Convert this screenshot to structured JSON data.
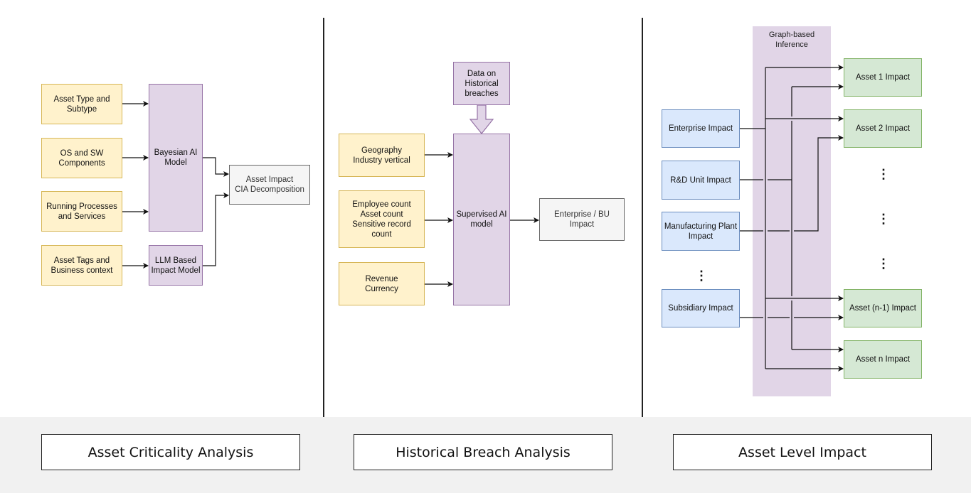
{
  "panel1": {
    "inputs": [
      "Asset Type and\nSubtype",
      "OS and SW\nComponents",
      "Running Processes\nand Services",
      "Asset Tags and\nBusiness context"
    ],
    "bayesian_model": "Bayesian AI\nModel",
    "llm_model": "LLM Based\nImpact Model",
    "output": "Asset Impact\nCIA Decomposition"
  },
  "panel2": {
    "historical_data": "Data on\nHistorical\nbreaches",
    "inputs": [
      "Geography\nIndustry vertical",
      "Employee count\nAsset count\nSensitive record\ncount",
      "Revenue\nCurrency"
    ],
    "model": "Supervised AI\nmodel",
    "output": "Enterprise / BU\nImpact"
  },
  "panel3": {
    "band_label": "Graph-based\nInference",
    "sources": [
      "Enterprise Impact",
      "R&D Unit Impact",
      "Manufacturing Plant\nImpact",
      "Subsidiary Impact"
    ],
    "targets": [
      "Asset 1 Impact",
      "Asset 2 Impact",
      "Asset (n-1) Impact",
      "Asset n Impact"
    ],
    "ellipsis": "⋮"
  },
  "footer": {
    "labels": [
      "Asset Criticality Analysis",
      "Historical Breach Analysis",
      "Asset Level Impact"
    ]
  },
  "colors": {
    "input_fill": "#fff2cc",
    "model_fill": "#e1d5e7",
    "source_fill": "#dae8fc",
    "target_fill": "#d5e8d4",
    "output_fill": "#f5f5f5"
  }
}
